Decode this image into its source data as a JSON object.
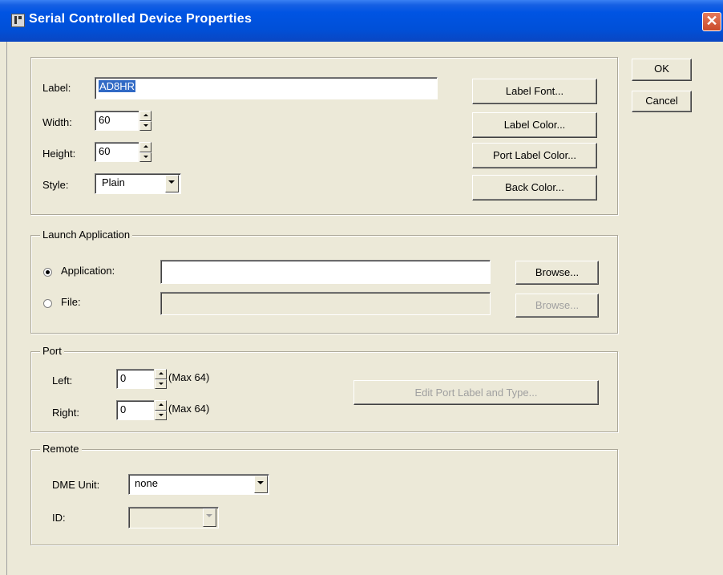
{
  "window": {
    "title": "Serial Controlled Device Properties",
    "close_glyph": "✕"
  },
  "dialog_buttons": {
    "ok": "OK",
    "cancel": "Cancel"
  },
  "general": {
    "label_caption": "Label:",
    "label_value": "AD8HR",
    "width_caption": "Width:",
    "width_value": "60",
    "height_caption": "Height:",
    "height_value": "60",
    "style_caption": "Style:",
    "style_value": "Plain",
    "label_font_button": "Label Font...",
    "label_color_button": "Label Color...",
    "port_label_color_button": "Port Label Color...",
    "back_color_button": "Back Color..."
  },
  "launch": {
    "legend": "Launch Application",
    "application_option": "Application:",
    "application_value": "",
    "file_option": "File:",
    "file_value": "",
    "selected": "application",
    "browse_label": "Browse..."
  },
  "port": {
    "legend": "Port",
    "left_caption": "Left:",
    "left_value": "0",
    "right_caption": "Right:",
    "right_value": "0",
    "max_note": "(Max 64)",
    "edit_button": "Edit Port Label and Type..."
  },
  "remote": {
    "legend": "Remote",
    "dme_caption": "DME Unit:",
    "dme_value": "none",
    "id_caption": "ID:",
    "id_value": ""
  },
  "colors": {
    "title_bar": "#0054e3",
    "face": "#ece9d8",
    "selection": "#316ac5",
    "close": "#c94a2a"
  }
}
